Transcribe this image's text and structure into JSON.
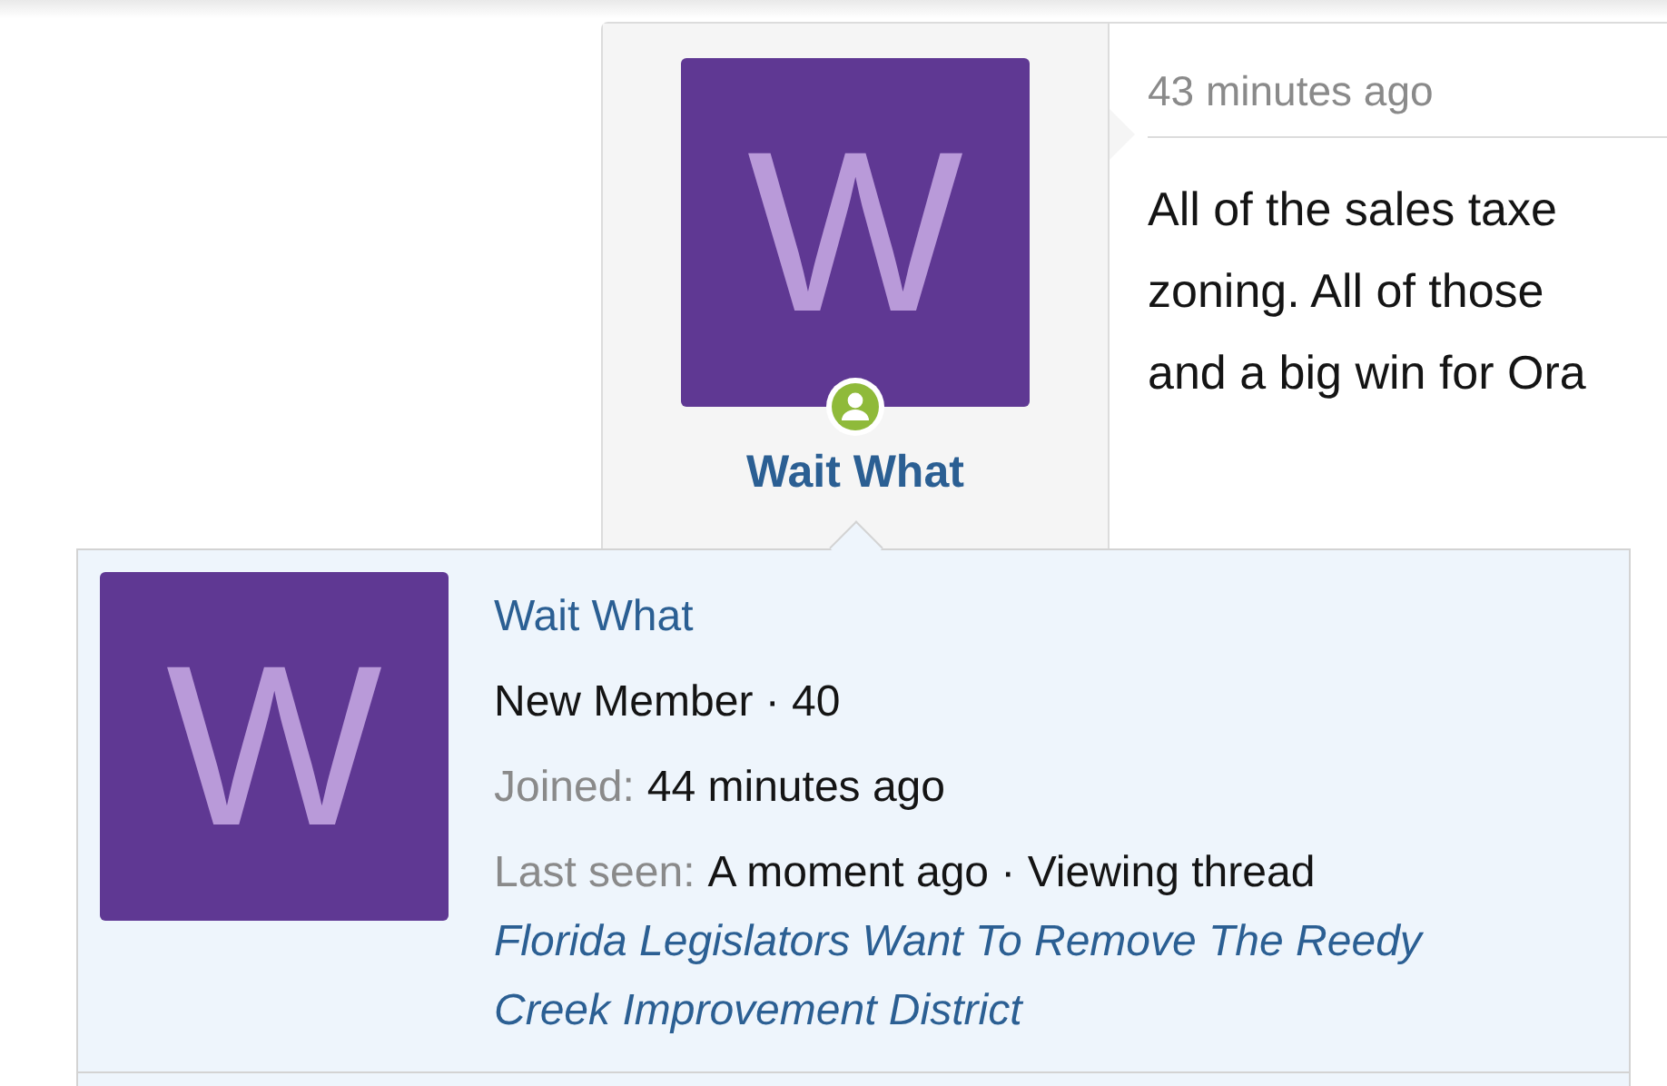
{
  "post": {
    "author": {
      "avatar_letter": "W",
      "online": true,
      "name": "Wait What"
    },
    "time": "43 minutes ago",
    "body_lines": [
      "All of the sales taxe",
      "zoning. All of those",
      "and a big win for Ora"
    ]
  },
  "tooltip": {
    "avatar_letter": "W",
    "name": "Wait What",
    "title_line": "New Member · 40",
    "joined_label": "Joined:",
    "joined_value": "44 minutes ago",
    "last_seen_label": "Last seen:",
    "last_seen_value": "A moment ago · Viewing thread",
    "thread_link": "Florida Legislators Want To Remove The Reedy Creek Improvement District"
  }
}
